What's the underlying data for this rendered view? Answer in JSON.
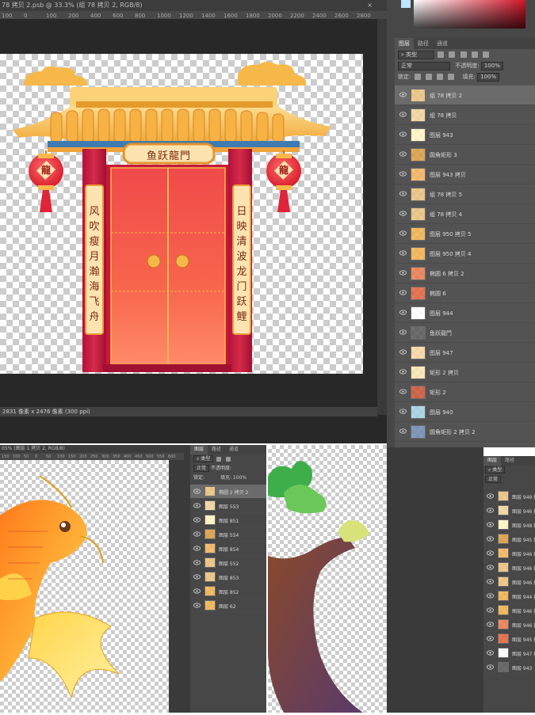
{
  "top_window": {
    "tab_title": "78 拷贝 2.psb @ 33.3% (组 78 拷贝 2, RGB/8)",
    "ruler_ticks": [
      "100",
      "0",
      "100",
      "200",
      "400",
      "600",
      "800",
      "1000",
      "1200",
      "1400",
      "1600",
      "1800",
      "2000",
      "2200",
      "2400",
      "2600",
      "2800"
    ],
    "status": "2831 像素 x 2476 像素 (300 ppi)",
    "artwork": {
      "sign": "鱼跃龍門",
      "lantern_char": "龍",
      "left_couplet": [
        "风",
        "吹",
        "瘦",
        "月",
        "瀚",
        "海",
        "飞",
        "舟"
      ],
      "right_couplet": [
        "日",
        "映",
        "清",
        "波",
        "龙",
        "门",
        "跃",
        "鲤"
      ]
    }
  },
  "layers_panel": {
    "tabs": [
      "图层",
      "路径",
      "通道"
    ],
    "filter_kind": "类型",
    "blend_mode": "正常",
    "opacity_label": "不透明度:",
    "opacity_value": "100%",
    "lock_label": "锁定:",
    "fill_label": "填充:",
    "fill_value": "100%",
    "layers": [
      {
        "name": "组 78 拷贝 2",
        "selected": true
      },
      {
        "name": "组 78 拷贝"
      },
      {
        "name": "图层 943"
      },
      {
        "name": "圆角矩形 3"
      },
      {
        "name": "图层 943 拷贝"
      },
      {
        "name": "组 78 拷贝 5"
      },
      {
        "name": "组 78 拷贝 4"
      },
      {
        "name": "图层 950 拷贝 5"
      },
      {
        "name": "图层 950 拷贝 4"
      },
      {
        "name": "椭圆 6 拷贝 2"
      },
      {
        "name": "椭圆 6"
      },
      {
        "name": "图层 944"
      },
      {
        "name": "鱼跃龍門"
      },
      {
        "name": "图层 947"
      },
      {
        "name": "矩形 2 拷贝"
      },
      {
        "name": "矩形 2"
      },
      {
        "name": "图层 940"
      },
      {
        "name": "圆角矩形 2 拷贝 2"
      }
    ]
  },
  "bottom_left_window": {
    "tab_title": "05% (图层 1 拷贝 2, RGB/8)",
    "ruler_ticks": [
      "150",
      "100",
      "50",
      "0",
      "50",
      "100",
      "150",
      "200",
      "250",
      "300",
      "350",
      "400",
      "450",
      "500",
      "550",
      "600"
    ]
  },
  "bottom_mid_panel": {
    "tabs": [
      "图层",
      "路径",
      "通道"
    ],
    "filter_kind": "类型",
    "blend_mode": "正常",
    "opacity_label": "不透明度:",
    "fill_label": "填充:",
    "fill_value": "100%",
    "lock_label": "锁定:",
    "layers": [
      {
        "name": "椭圆 2 拷贝 2",
        "selected": true
      },
      {
        "name": "图层 553"
      },
      {
        "name": "图层 851"
      },
      {
        "name": "图层 554"
      },
      {
        "name": "图层 854"
      },
      {
        "name": "图层 552"
      },
      {
        "name": "图层 853"
      },
      {
        "name": "图层 852"
      },
      {
        "name": "图层 62"
      }
    ]
  },
  "bottom_right_panel": {
    "tabs": [
      "图层",
      "路径",
      "通道"
    ],
    "filter_kind": "类型",
    "blend_mode": "正常",
    "layers": [
      {
        "name": "图层 949 拷贝"
      },
      {
        "name": "图层 946 拷贝"
      },
      {
        "name": "图层 948 拷贝"
      },
      {
        "name": "图层 945 拷贝"
      },
      {
        "name": "图层 946 拷贝"
      },
      {
        "name": "图层 946 拷贝"
      },
      {
        "name": "图层 946 拷贝"
      },
      {
        "name": "图层 944 拷贝"
      },
      {
        "name": "图层 946 拷贝"
      },
      {
        "name": "图层 946 拷贝"
      },
      {
        "name": "图层 945 拷贝"
      },
      {
        "name": "图层 947 拷贝"
      },
      {
        "name": "图层 943"
      }
    ]
  }
}
